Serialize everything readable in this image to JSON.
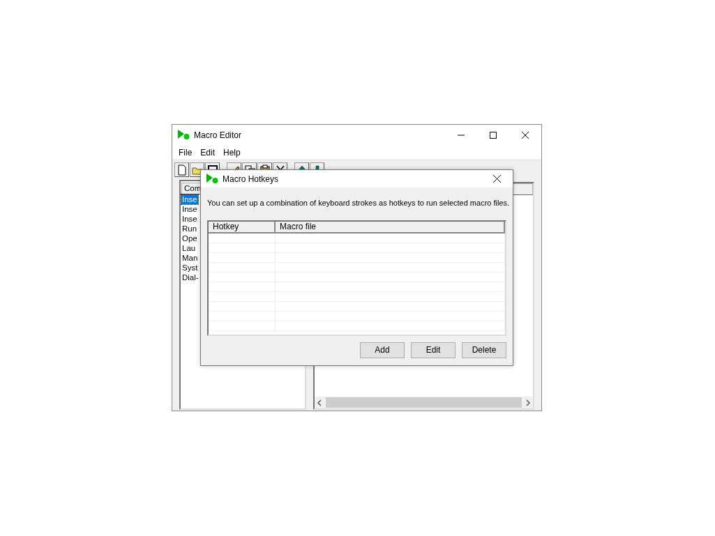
{
  "main_window": {
    "title": "Macro Editor",
    "menu": [
      "File",
      "Edit",
      "Help"
    ],
    "command_list": {
      "header": "Com",
      "items": [
        {
          "label": "Inse",
          "selected": true
        },
        {
          "label": "Inse",
          "selected": false
        },
        {
          "label": "Inse",
          "selected": false
        },
        {
          "label": "Run",
          "selected": false
        },
        {
          "label": "Ope",
          "selected": false
        },
        {
          "label": "Lau",
          "selected": false
        },
        {
          "label": "Man",
          "selected": false
        },
        {
          "label": "Syst",
          "selected": false
        },
        {
          "label": "Dial-",
          "selected": false
        }
      ]
    }
  },
  "dialog": {
    "title": "Macro Hotkeys",
    "description": "You can set up a combination of keyboard strokes as hotkeys to run selected macro files.",
    "table": {
      "columns": [
        "Hotkey",
        "Macro file"
      ]
    },
    "buttons": [
      "Add",
      "Edit",
      "Delete"
    ]
  }
}
